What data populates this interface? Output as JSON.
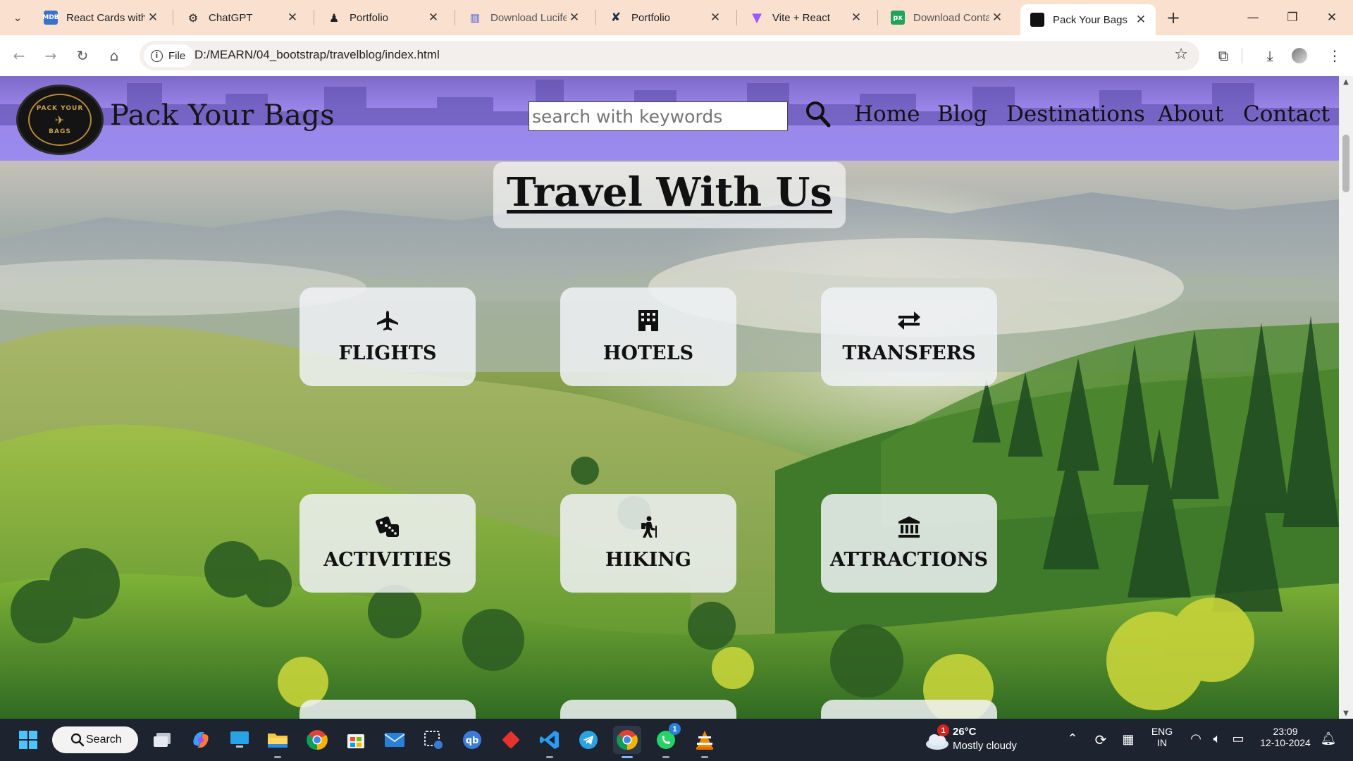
{
  "browser": {
    "tabs": [
      {
        "title": "React Cards with",
        "favicon": "mdb-logo",
        "color": "#3b71ca"
      },
      {
        "title": "ChatGPT",
        "favicon": "openai-logo",
        "color": "#222222"
      },
      {
        "title": "Portfolio",
        "favicon": "person-icon",
        "color": "#222222"
      },
      {
        "title": "Download Lucife",
        "favicon": "lucifer-logo",
        "color": "#3b5bdb"
      },
      {
        "title": "Portfolio",
        "favicon": "x-logo",
        "color": "#1f2a44"
      },
      {
        "title": "Vite + React",
        "favicon": "vite-logo",
        "color": "#9b59ff"
      },
      {
        "title": "Download Conta",
        "favicon": "px-logo",
        "color": "#21a35a"
      },
      {
        "title": "Pack Your Bags",
        "favicon": "site-logo",
        "color": "#111111"
      }
    ],
    "active_tab_index": 7,
    "address_chip": "File",
    "url": "D:/MEARN/04_bootstrap/travelblog/index.html"
  },
  "site": {
    "brand": "Pack Your Bags",
    "logo_text_top": "PACK YOUR",
    "logo_text_bottom": "BAGS",
    "search_placeholder": "search with keywords",
    "nav": [
      "Home",
      "Blog",
      "Destinations",
      "About",
      "Contact"
    ],
    "hero_title": "Travel With Us",
    "services": [
      {
        "label": "FLIGHTS",
        "icon": "plane-icon"
      },
      {
        "label": "HOTELS",
        "icon": "hotel-building-icon"
      },
      {
        "label": "TRANSFERS",
        "icon": "transfer-arrows-icon"
      },
      {
        "label": "ACTIVITIES",
        "icon": "dice-icon"
      },
      {
        "label": "HIKING",
        "icon": "person-hiking-icon"
      },
      {
        "label": "ATTRACTIONS",
        "icon": "landmark-icon"
      }
    ],
    "header_color": "#9b8bef"
  },
  "taskbar": {
    "search_label": "Search",
    "weather_temp": "26°C",
    "weather_desc": "Mostly cloudy",
    "weather_badge": "1",
    "whatsapp_badge": "1",
    "lang_top": "ENG",
    "lang_bottom": "IN",
    "time": "23:09",
    "date": "12-10-2024"
  }
}
